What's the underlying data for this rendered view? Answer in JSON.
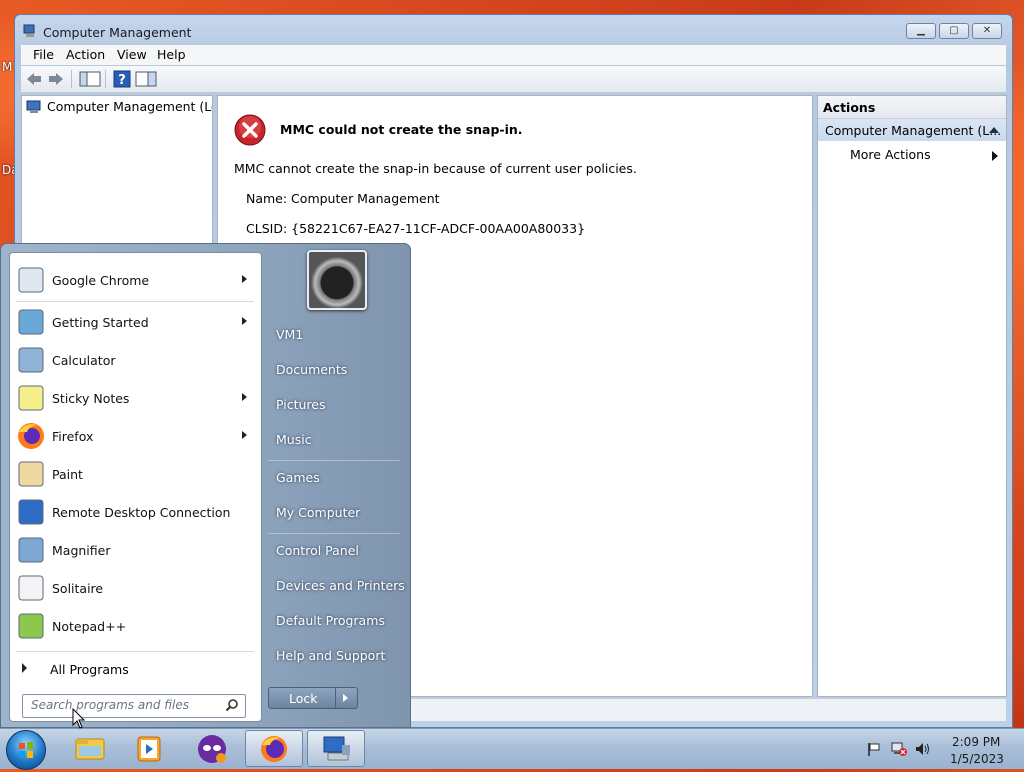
{
  "desktop": {
    "letters": [
      "M",
      "Da"
    ]
  },
  "window": {
    "title": "Computer Management",
    "menu": [
      "File",
      "Action",
      "View",
      "Help"
    ],
    "tree_item": "Computer Management (Local",
    "error": {
      "title": "MMC could not create the snap-in.",
      "message": "MMC cannot create the snap-in because of current user policies.",
      "name": "Name: Computer Management",
      "clsid": "CLSID: {58221C67-EA27-11CF-ADCF-00AA00A80033}"
    },
    "actions": {
      "header": "Actions",
      "group": "Computer Management (L...",
      "more": "More Actions"
    }
  },
  "start_menu": {
    "programs": [
      {
        "label": "Google Chrome",
        "icon": "chrome-icon",
        "submenu": true
      },
      {
        "label": "Getting Started",
        "icon": "getting-started-icon",
        "submenu": true
      },
      {
        "label": "Calculator",
        "icon": "calculator-icon",
        "submenu": false
      },
      {
        "label": "Sticky Notes",
        "icon": "sticky-notes-icon",
        "submenu": true
      },
      {
        "label": "Firefox",
        "icon": "firefox-icon",
        "submenu": true
      },
      {
        "label": "Paint",
        "icon": "paint-icon",
        "submenu": false
      },
      {
        "label": "Remote Desktop Connection",
        "icon": "remote-desktop-icon",
        "submenu": false
      },
      {
        "label": "Magnifier",
        "icon": "magnifier-icon",
        "submenu": false
      },
      {
        "label": "Solitaire",
        "icon": "solitaire-icon",
        "submenu": false
      },
      {
        "label": "Notepad++",
        "icon": "notepad-plus-plus-icon",
        "submenu": false
      }
    ],
    "all_programs": "All Programs",
    "search_placeholder": "Search programs and files",
    "right_links": [
      "VM1",
      "Documents",
      "Pictures",
      "Music",
      "Games",
      "My Computer",
      "Control Panel",
      "Devices and Printers",
      "Default Programs",
      "Help and Support"
    ],
    "lock_label": "Lock"
  },
  "taskbar": {
    "items": [
      "file-explorer-icon",
      "media-player-icon",
      "vpn-mask-icon",
      "firefox-icon",
      "computer-management-icon"
    ],
    "active": "computer-management-icon",
    "time": "2:09 PM",
    "date": "1/5/2023"
  }
}
